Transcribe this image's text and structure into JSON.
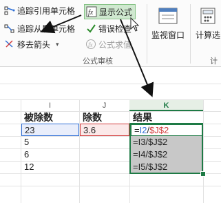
{
  "ribbon": {
    "trace_precedents": "追踪引用单元格",
    "trace_dependents": "追踪从属单元格",
    "remove_arrows": "移去箭头",
    "show_formulas": "显示公式",
    "error_checking": "错误检查",
    "evaluate_formula": "公式求值",
    "group_label": "公式审核",
    "watch_window": "监视窗口",
    "calculate": "计算选",
    "calc_group_label": "计"
  },
  "sheet": {
    "column_headers": [
      "I",
      "J",
      "K"
    ],
    "headers": {
      "col_i": "被除数",
      "col_j": "除数",
      "col_k": "结果"
    },
    "rows": [
      {
        "i": "23",
        "j": "3.6",
        "k_parts": [
          "=",
          "I2",
          "/",
          "$J$2"
        ]
      },
      {
        "i": "5",
        "j": "",
        "k": "=I3/$J$2"
      },
      {
        "i": "6",
        "j": "",
        "k": "=I4/$J$2"
      },
      {
        "i": "12",
        "j": "",
        "k": "=I5/$J$2"
      }
    ]
  },
  "colors": {
    "ref_i": "#2f6fd6",
    "ref_j": "#d23c3c",
    "result_green": "#1e7a45",
    "selection_fill": "#c8c8c8"
  }
}
